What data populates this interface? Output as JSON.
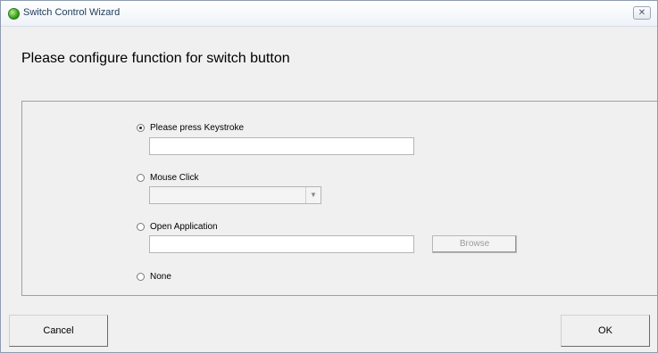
{
  "window": {
    "title": "Switch Control Wizard",
    "close_glyph": "✕",
    "icon": "green-circle-icon"
  },
  "header": {
    "text": "Please configure function for switch button"
  },
  "options": {
    "keystroke": {
      "label": "Please press Keystroke",
      "selected": true,
      "value": ""
    },
    "mouse_click": {
      "label": "Mouse Click",
      "selected": false,
      "value": ""
    },
    "open_application": {
      "label": "Open Application",
      "selected": false,
      "value": ""
    },
    "none": {
      "label": "None",
      "selected": false
    }
  },
  "browse_button": {
    "label": "Browse"
  },
  "footer": {
    "cancel_label": "Cancel",
    "ok_label": "OK"
  }
}
